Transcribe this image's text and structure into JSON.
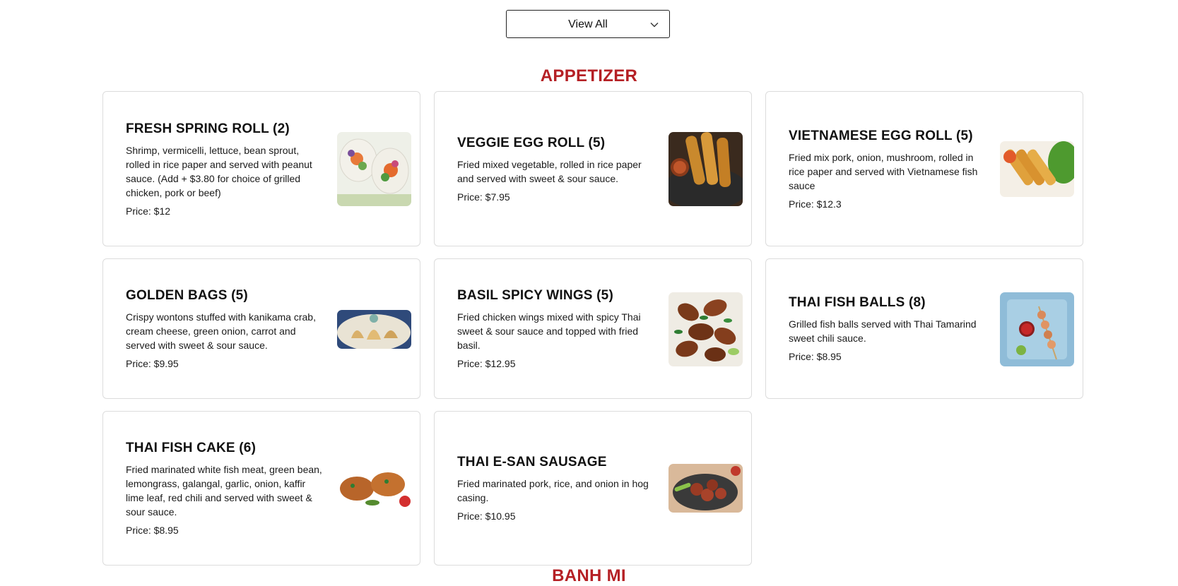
{
  "filter": {
    "selected": "View All",
    "icon": "chevron-down-icon"
  },
  "sections": [
    {
      "title": "APPETIZER",
      "items": [
        {
          "name": "FRESH SPRING ROLL (2)",
          "description": "Shrimp, vermicelli, lettuce, bean sprout, rolled in rice paper and served with peanut sauce. (Add + $3.80 for choice of grilled chicken, pork or beef)",
          "price": "Price: $12",
          "image": "fresh-spring-roll-photo"
        },
        {
          "name": "VEGGIE EGG ROLL (5)",
          "description": "Fried mixed vegetable, rolled in rice paper and served with sweet & sour sauce.",
          "price": "Price: $7.95",
          "image": "veggie-egg-roll-photo"
        },
        {
          "name": "VIETNAMESE EGG ROLL (5)",
          "description": "Fried mix pork, onion, mushroom, rolled in rice paper and served with Vietnamese fish sauce",
          "price": "Price: $12.3",
          "image": "vietnamese-egg-roll-photo"
        },
        {
          "name": "GOLDEN BAGS (5)",
          "description": "Crispy wontons stuffed with kanikama crab, cream cheese, green onion, carrot and served with sweet & sour sauce.",
          "price": "Price: $9.95",
          "image": "golden-bags-photo"
        },
        {
          "name": "BASIL SPICY WINGS (5)",
          "description": "Fried chicken wings mixed with spicy Thai sweet & sour sauce and topped with fried basil.",
          "price": "Price: $12.95",
          "image": "basil-spicy-wings-photo"
        },
        {
          "name": "THAI FISH BALLS (8)",
          "description": "Grilled fish balls served with Thai Tamarind sweet chili sauce.",
          "price": "Price: $8.95",
          "image": "thai-fish-balls-photo"
        },
        {
          "name": "THAI FISH CAKE (6)",
          "description": "Fried marinated white fish meat, green bean, lemongrass, galangal, garlic, onion, kaffir lime leaf, red chili and served with sweet & sour sauce.",
          "price": "Price: $8.95",
          "image": "thai-fish-cake-photo"
        },
        {
          "name": "THAI E-SAN SAUSAGE",
          "description": "Fried marinated pork, rice, and onion in hog casing.",
          "price": "Price: $10.95",
          "image": "thai-esan-sausage-photo"
        }
      ]
    },
    {
      "title": "BANH MI",
      "items": []
    }
  ],
  "colors": {
    "section_title": "#b52025",
    "card_border": "#dcdcdc"
  }
}
